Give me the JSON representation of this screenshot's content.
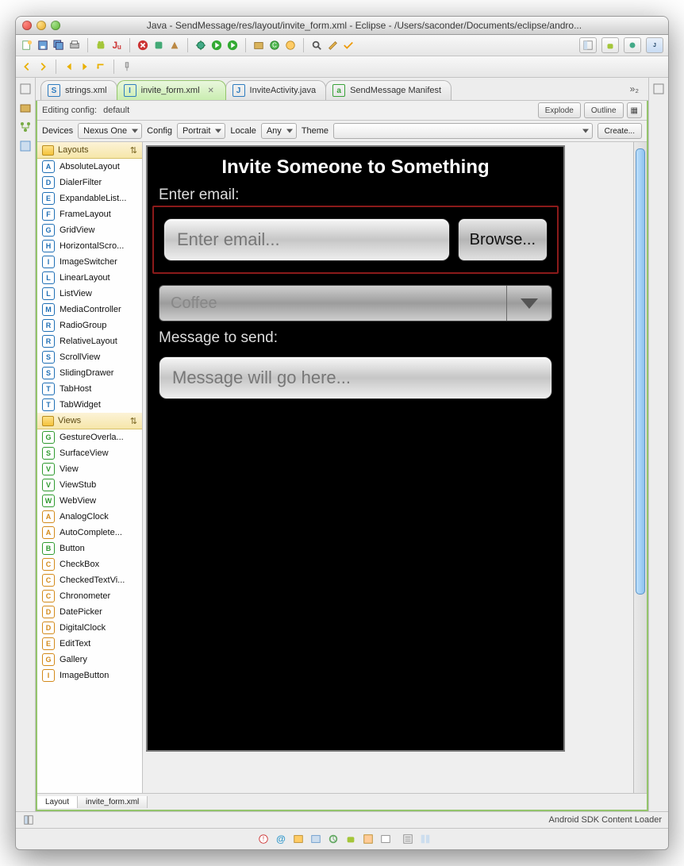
{
  "window": {
    "title": "Java - SendMessage/res/layout/invite_form.xml - Eclipse - /Users/saconder/Documents/eclipse/andro..."
  },
  "editor_tabs": {
    "overflow": "»₂",
    "items": [
      {
        "label": "strings.xml",
        "iconLetter": "S",
        "iconColor": "#2e7cc0"
      },
      {
        "label": "invite_form.xml",
        "iconLetter": "I",
        "iconColor": "#2e7cc0",
        "active": true
      },
      {
        "label": "InviteActivity.java",
        "iconLetter": "J",
        "iconColor": "#2e7cc0"
      },
      {
        "label": "SendMessage Manifest",
        "iconLetter": "a",
        "iconColor": "#3aa23a"
      }
    ]
  },
  "editor": {
    "editing_config_label": "Editing config:",
    "editing_config_value": "default",
    "buttons": {
      "explode": "Explode",
      "outline": "Outline",
      "create": "Create..."
    },
    "cfgbar": {
      "devices_label": "Devices",
      "device": "Nexus One",
      "config_label": "Config",
      "config": "Portrait",
      "locale_label": "Locale",
      "locale": "Any",
      "theme_label": "Theme",
      "theme": ""
    },
    "bottom_tabs": {
      "layout": "Layout",
      "source": "invite_form.xml"
    }
  },
  "palette": {
    "groups": [
      {
        "name": "Layouts",
        "items": [
          {
            "letter": "A",
            "color": "#1f6fb5",
            "label": "AbsoluteLayout"
          },
          {
            "letter": "D",
            "color": "#1f6fb5",
            "label": "DialerFilter"
          },
          {
            "letter": "E",
            "color": "#1f6fb5",
            "label": "ExpandableList..."
          },
          {
            "letter": "F",
            "color": "#1f6fb5",
            "label": "FrameLayout"
          },
          {
            "letter": "G",
            "color": "#1f6fb5",
            "label": "GridView"
          },
          {
            "letter": "H",
            "color": "#1f6fb5",
            "label": "HorizontalScro..."
          },
          {
            "letter": "I",
            "color": "#1f6fb5",
            "label": "ImageSwitcher"
          },
          {
            "letter": "L",
            "color": "#1f6fb5",
            "label": "LinearLayout"
          },
          {
            "letter": "L",
            "color": "#1f6fb5",
            "label": "ListView"
          },
          {
            "letter": "M",
            "color": "#1f6fb5",
            "label": "MediaController"
          },
          {
            "letter": "R",
            "color": "#1f6fb5",
            "label": "RadioGroup"
          },
          {
            "letter": "R",
            "color": "#1f6fb5",
            "label": "RelativeLayout"
          },
          {
            "letter": "S",
            "color": "#1f6fb5",
            "label": "ScrollView"
          },
          {
            "letter": "S",
            "color": "#1f6fb5",
            "label": "SlidingDrawer"
          },
          {
            "letter": "T",
            "color": "#1f6fb5",
            "label": "TabHost"
          },
          {
            "letter": "T",
            "color": "#1f6fb5",
            "label": "TabWidget"
          }
        ]
      },
      {
        "name": "Views",
        "items": [
          {
            "letter": "G",
            "color": "#2f9a2f",
            "label": "GestureOverla..."
          },
          {
            "letter": "S",
            "color": "#2f9a2f",
            "label": "SurfaceView"
          },
          {
            "letter": "V",
            "color": "#2f9a2f",
            "label": "View"
          },
          {
            "letter": "V",
            "color": "#2f9a2f",
            "label": "ViewStub"
          },
          {
            "letter": "W",
            "color": "#2f9a2f",
            "label": "WebView"
          },
          {
            "letter": "A",
            "color": "#d38a1a",
            "label": "AnalogClock"
          },
          {
            "letter": "A",
            "color": "#d38a1a",
            "label": "AutoComplete..."
          },
          {
            "letter": "B",
            "color": "#2f9a2f",
            "label": "Button"
          },
          {
            "letter": "C",
            "color": "#d38a1a",
            "label": "CheckBox"
          },
          {
            "letter": "C",
            "color": "#d38a1a",
            "label": "CheckedTextVi..."
          },
          {
            "letter": "C",
            "color": "#d38a1a",
            "label": "Chronometer"
          },
          {
            "letter": "D",
            "color": "#d38a1a",
            "label": "DatePicker"
          },
          {
            "letter": "D",
            "color": "#d38a1a",
            "label": "DigitalClock"
          },
          {
            "letter": "E",
            "color": "#d38a1a",
            "label": "EditText"
          },
          {
            "letter": "G",
            "color": "#d38a1a",
            "label": "Gallery"
          },
          {
            "letter": "I",
            "color": "#d38a1a",
            "label": "ImageButton"
          }
        ]
      }
    ]
  },
  "device_preview": {
    "title": "Invite Someone to Something",
    "email_label": "Enter email:",
    "email_placeholder": "Enter email...",
    "browse_label": "Browse...",
    "spinner_value": "Coffee",
    "message_label": "Message to send:",
    "message_placeholder": "Message will go here..."
  },
  "statusbar": {
    "right": "Android SDK Content Loader"
  }
}
